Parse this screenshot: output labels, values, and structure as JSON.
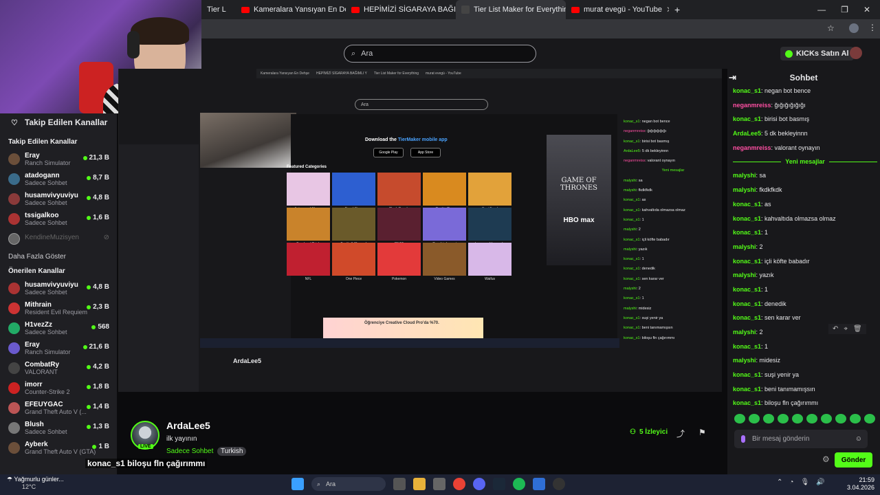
{
  "tabs": [
    {
      "label": "Tier L",
      "icon": "youtube-icon"
    },
    {
      "label": "Kameralara Yansıyan En Dehşe",
      "icon": "youtube-icon"
    },
    {
      "label": "HEPİMİZİ SİGARAYA BAĞIMLI Y",
      "icon": "youtube-icon"
    },
    {
      "label": "Tier List Maker for Everything",
      "icon": "tierlist-icon"
    },
    {
      "label": "murat evegü - YouTube",
      "icon": "youtube-icon"
    }
  ],
  "header": {
    "search_placeholder": "Ara",
    "kicks_label": "KICKs Satın Al"
  },
  "sidebar": {
    "title": "Takip Edilen Kanallar",
    "followed_header": "Takip Edilen Kanallar",
    "followed": [
      {
        "name": "Eray",
        "category": "Ranch Simulator",
        "viewers": "21,3 B"
      },
      {
        "name": "atadogann",
        "category": "Sadece Sohbet",
        "viewers": "8,7 B"
      },
      {
        "name": "husamvivyuviyu",
        "category": "Sadece Sohbet",
        "viewers": "4,8 B"
      },
      {
        "name": "tssigalkoo",
        "category": "Sadece Sohbet",
        "viewers": "1,6 B"
      }
    ],
    "offline": "KendineMuzisyen",
    "more_label": "Daha Fazla Göster",
    "recommended_header": "Önerilen Kanallar",
    "recommended": [
      {
        "name": "husamvivyuviyu",
        "category": "Sadece Sohbet",
        "viewers": "4,8 B"
      },
      {
        "name": "Mithrain",
        "category": "Resident Evil Requiem",
        "viewers": "2,3 B"
      },
      {
        "name": "H1vezZz",
        "category": "Sadece Sohbet",
        "viewers": "568"
      },
      {
        "name": "Eray",
        "category": "Ranch Simulator",
        "viewers": "21,6 B"
      },
      {
        "name": "CombatRy",
        "category": "VALORANT",
        "viewers": "4,2 B"
      },
      {
        "name": "imorr",
        "category": "Counter-Strike 2",
        "viewers": "1,8 B"
      },
      {
        "name": "EFEUYGAC",
        "category": "Grand Theft Auto V (...",
        "viewers": "1,4 B"
      },
      {
        "name": "Blush",
        "category": "Sadece Sohbet",
        "viewers": "1,3 B"
      },
      {
        "name": "Ayberk",
        "category": "Grand Theft Auto V (GTA)",
        "viewers": "1 B"
      }
    ]
  },
  "nested": {
    "search_placeholder": "Ara",
    "download_prefix": "Download the",
    "download_link": "TierMaker mobile app",
    "google_play": "Google Play",
    "app_store": "App Store",
    "featured": "Featured Categories",
    "categories": [
      "Anime and Manga",
      "Brawl Stars",
      "Clash Royale",
      "Cookie Run",
      "Fast Food",
      "Food and Drink",
      "Football (Soccer)",
      "FNAF",
      "Genshin Impact",
      "League of Legends",
      "NFL",
      "One Piece",
      "Pokemon",
      "Video Games",
      "Waifus"
    ],
    "poster_title": "GAME OF THRONES",
    "poster_brand": "HBO max",
    "ad_text": "Öğrenciye Creative Cloud Pro'da %70.",
    "streamer": "ArdaLee5"
  },
  "stream": {
    "name": "ArdaLee5",
    "title": "ilk yayının",
    "category": "Sadece Sohbet",
    "tag": "Turkish",
    "live": "LIVE",
    "overlay": "konac_s1  biloşu fln çağırımmı",
    "viewers": "5 İzleyici"
  },
  "chat": {
    "title": "Sohbet",
    "new_messages": "Yeni mesajlar",
    "placeholder": "Bir mesaj gönderin",
    "send": "Gönder",
    "old": [
      {
        "user": "konac_s1",
        "text": "negan bot bence",
        "color": "#53fc18"
      },
      {
        "user": "neganmreiss",
        "text": "ğığığığığığı",
        "color": "#ff4fa3"
      },
      {
        "user": "konac_s1",
        "text": "birisi bot basmış",
        "color": "#53fc18"
      },
      {
        "user": "ArdaLee5",
        "text": "5 dk bekleyinnn",
        "color": "#53fc18"
      },
      {
        "user": "neganmreiss",
        "text": "valorant oynayın",
        "color": "#ff4fa3"
      }
    ],
    "new": [
      {
        "user": "malyshi",
        "text": "sa"
      },
      {
        "user": "malyshi",
        "text": "fkdkfkdk"
      },
      {
        "user": "konac_s1",
        "text": "as"
      },
      {
        "user": "konac_s1",
        "text": "kahvaltıda olmazsa olmaz"
      },
      {
        "user": "konac_s1",
        "text": "1"
      },
      {
        "user": "malyshi",
        "text": "2"
      },
      {
        "user": "konac_s1",
        "text": "içli köfte babadır"
      },
      {
        "user": "malyshi",
        "text": "yazık"
      },
      {
        "user": "konac_s1",
        "text": "1"
      },
      {
        "user": "konac_s1",
        "text": "denedik"
      },
      {
        "user": "konac_s1",
        "text": "sen karar ver"
      },
      {
        "user": "malyshi",
        "text": "2"
      },
      {
        "user": "konac_s1",
        "text": "1"
      },
      {
        "user": "malyshi",
        "text": "midesiz"
      },
      {
        "user": "konac_s1",
        "text": "suşi yenir ya"
      },
      {
        "user": "konac_s1",
        "text": "beni tanımamışsın"
      },
      {
        "user": "konac_s1",
        "text": "biloşu fln çağırımmı"
      }
    ]
  },
  "taskbar": {
    "weather_text": "Yağmurlu günler...",
    "temp": "12°C",
    "search": "Ara",
    "time": "21:59",
    "date": "3.04.2026"
  }
}
